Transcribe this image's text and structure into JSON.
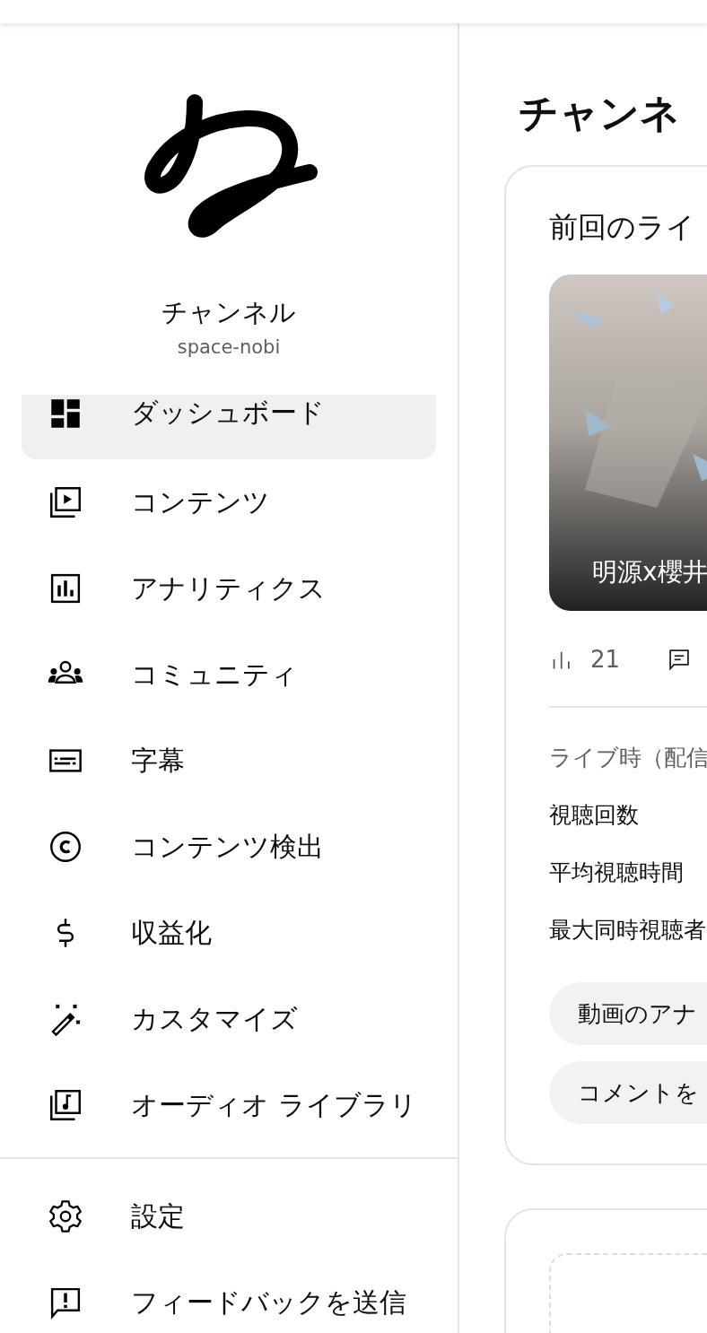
{
  "sidebar": {
    "channel": {
      "name": "チャンネル",
      "handle": "space-nobi"
    },
    "nav_items": [
      {
        "label": "ダッシュボード",
        "selected": true
      },
      {
        "label": "コンテンツ",
        "selected": false
      },
      {
        "label": "アナリティクス",
        "selected": false
      },
      {
        "label": "コミュニティ",
        "selected": false
      },
      {
        "label": "字幕",
        "selected": false
      },
      {
        "label": "コンテンツ検出",
        "selected": false
      },
      {
        "label": "収益化",
        "selected": false
      },
      {
        "label": "カスタマイズ",
        "selected": false
      },
      {
        "label": "オーディオ ライブラリ",
        "selected": false
      }
    ],
    "footer_items": [
      {
        "label": "設定"
      },
      {
        "label": "フィードバックを送信"
      }
    ]
  },
  "main": {
    "title": "チャンネ",
    "card": {
      "title": "前回のライ",
      "thumbnail": {
        "kind": "picture",
        "caption": "明源x櫻井"
      },
      "views": "21",
      "section_label": "ライブ時（配信",
      "metrics": [
        "視聴回数",
        "平均視聴時間",
        "最大同時視聴者"
      ],
      "buttons": [
        "動画のアナ",
        "コメントを"
      ]
    }
  }
}
